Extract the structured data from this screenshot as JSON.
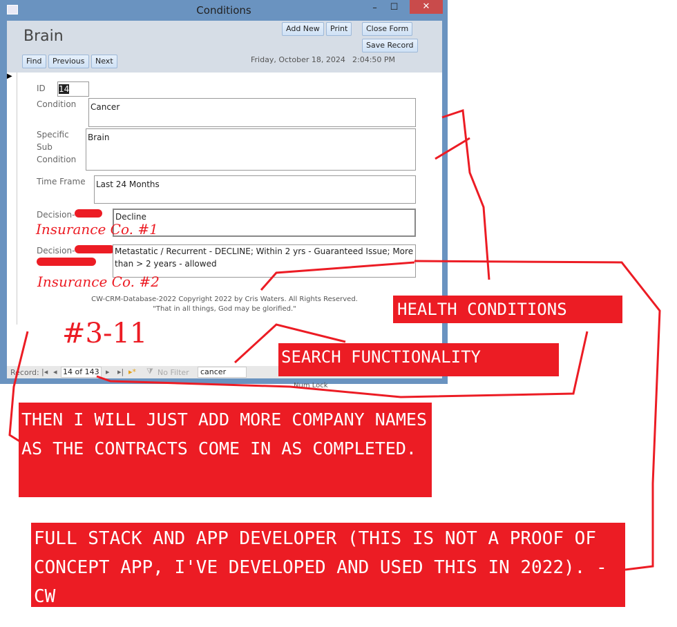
{
  "window": {
    "title": "Conditions",
    "minimize": "–",
    "maximize": "☐",
    "close": "✕"
  },
  "header": {
    "title": "Brain",
    "add_new": "Add New",
    "print": "Print",
    "close_form": "Close Form",
    "save_record": "Save Record",
    "find": "Find",
    "previous": "Previous",
    "next": "Next",
    "date": "Friday, October 18, 2024",
    "time": "2:04:50 PM"
  },
  "fields": {
    "id_label": "ID",
    "id_value": "14",
    "condition_label": "Condition",
    "condition_value": "Cancer",
    "sub_label": "Specific Sub Condition",
    "sub_value": "Brain",
    "time_label": "Time Frame",
    "time_value": "Last 24 Months",
    "decision1_label": "Decision-",
    "decision1_value": "Decline",
    "decision2_label": "Decision-",
    "decision2_value": "Metastatic / Recurrent - DECLINE; Within 2 yrs - Guaranteed Issue;  More than > 2 years - allowed"
  },
  "footer": {
    "copyright": "CW-CRM-Database-2022 Copyright 2022 by Cris Waters.  All Rights Reserved.",
    "quote": "\"That in all things, God may be glorified.\""
  },
  "record_bar": {
    "label": "Record:",
    "position": "14 of 143",
    "filter": "No Filter",
    "search": "cancer"
  },
  "status": {
    "num_lock": "Num Lock"
  },
  "annotations": {
    "ins1": "Insurance Co. #1",
    "ins2": "Insurance Co. #2",
    "num": "#3-11",
    "health": "HEALTH CONDITIONS",
    "search": "SEARCH FUNCTIONALITY",
    "more": "THEN I WILL JUST ADD MORE COMPANY NAMES AS THE CONTRACTS COME IN AS COMPLETED.",
    "dev": "FULL STACK AND APP DEVELOPER (THIS IS NOT A PROOF OF CONCEPT APP, I'VE DEVELOPED AND USED THIS IN 2022). - CW"
  },
  "colors": {
    "annotation_red": "#ec1c24",
    "titlebar": "#6a93c0"
  }
}
